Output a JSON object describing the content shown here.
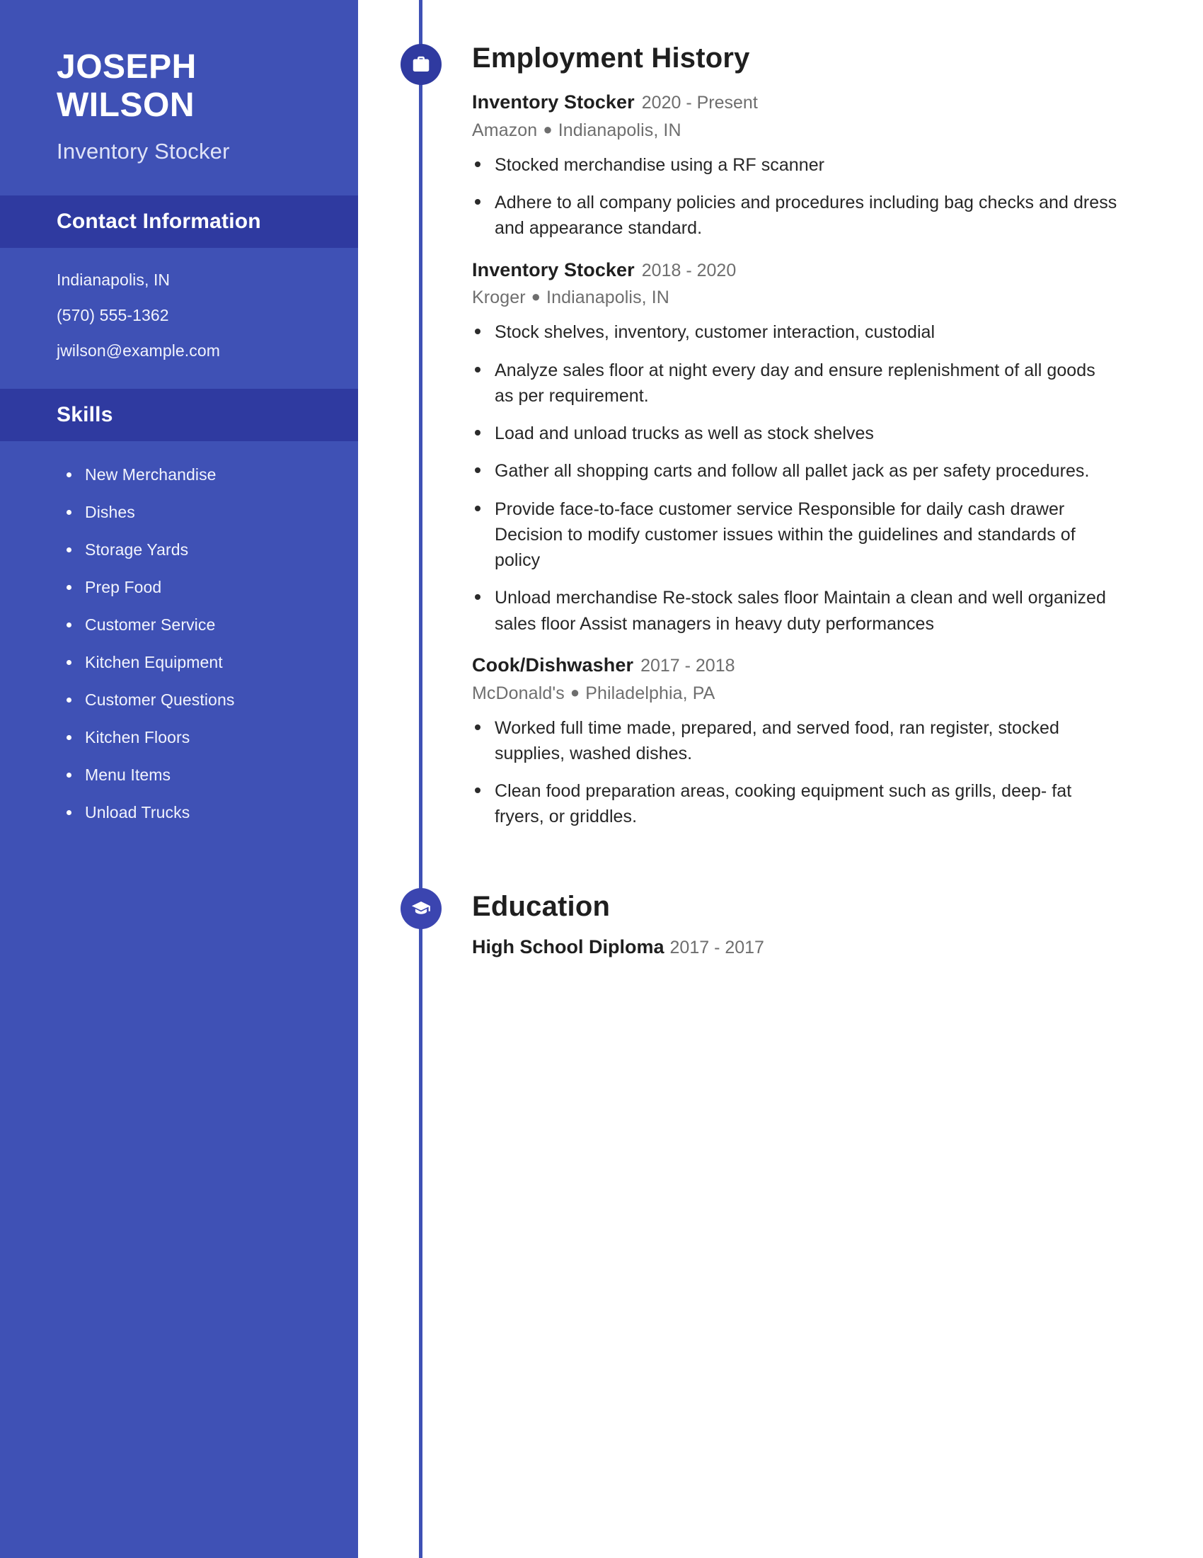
{
  "sidebar": {
    "first_name": "JOSEPH",
    "last_name": "WILSON",
    "job_title": "Inventory Stocker",
    "contact_heading": "Contact Information",
    "contact": [
      "Indianapolis, IN",
      "(570) 555-1362",
      "jwilson@example.com"
    ],
    "skills_heading": "Skills",
    "skills": [
      "New Merchandise",
      "Dishes",
      "Storage Yards",
      "Prep Food",
      "Customer Service",
      "Kitchen Equipment",
      "Customer Questions",
      "Kitchen Floors",
      "Menu Items",
      "Unload Trucks"
    ]
  },
  "main": {
    "employment": {
      "heading": "Employment History",
      "icon": "briefcase-icon",
      "jobs": [
        {
          "role": "Inventory Stocker",
          "dates": "2020 - Present",
          "company": "Amazon",
          "location": "Indianapolis, IN",
          "bullets": [
            "Stocked merchandise using a RF scanner",
            "Adhere to all company policies and procedures including bag checks and dress and appearance standard."
          ]
        },
        {
          "role": "Inventory Stocker",
          "dates": "2018 - 2020",
          "company": "Kroger",
          "location": "Indianapolis, IN",
          "bullets": [
            "Stock shelves, inventory, customer interaction, custodial",
            "Analyze sales floor at night every day and ensure replenishment of all goods as per requirement.",
            "Load and unload trucks as well as stock shelves",
            "Gather all shopping carts and follow all pallet jack as per safety procedures.",
            "Provide face-to-face customer service Responsible for daily cash drawer Decision to modify customer issues within the guidelines and standards of policy",
            "Unload merchandise Re-stock sales floor Maintain a clean and well organized sales floor Assist managers in heavy duty performances"
          ]
        },
        {
          "role": "Cook/Dishwasher",
          "dates": "2017 - 2018",
          "company": "McDonald's",
          "location": "Philadelphia, PA",
          "bullets": [
            "Worked full time made, prepared, and served food, ran register, stocked supplies, washed dishes.",
            "Clean food preparation areas, cooking equipment such as grills, deep- fat fryers, or griddles."
          ]
        }
      ]
    },
    "education": {
      "heading": "Education",
      "icon": "graduation-cap-icon",
      "entries": [
        {
          "degree": "High School Diploma",
          "dates": "2017 - 2017"
        }
      ]
    }
  },
  "colors": {
    "sidebar_bg": "#3f51b5",
    "band_bg": "#2f3aa0",
    "accent": "#3f51b5",
    "icon_circle": "#2f3aa0",
    "text_dark": "#1f1f1f",
    "text_muted": "#6e6e6e"
  }
}
